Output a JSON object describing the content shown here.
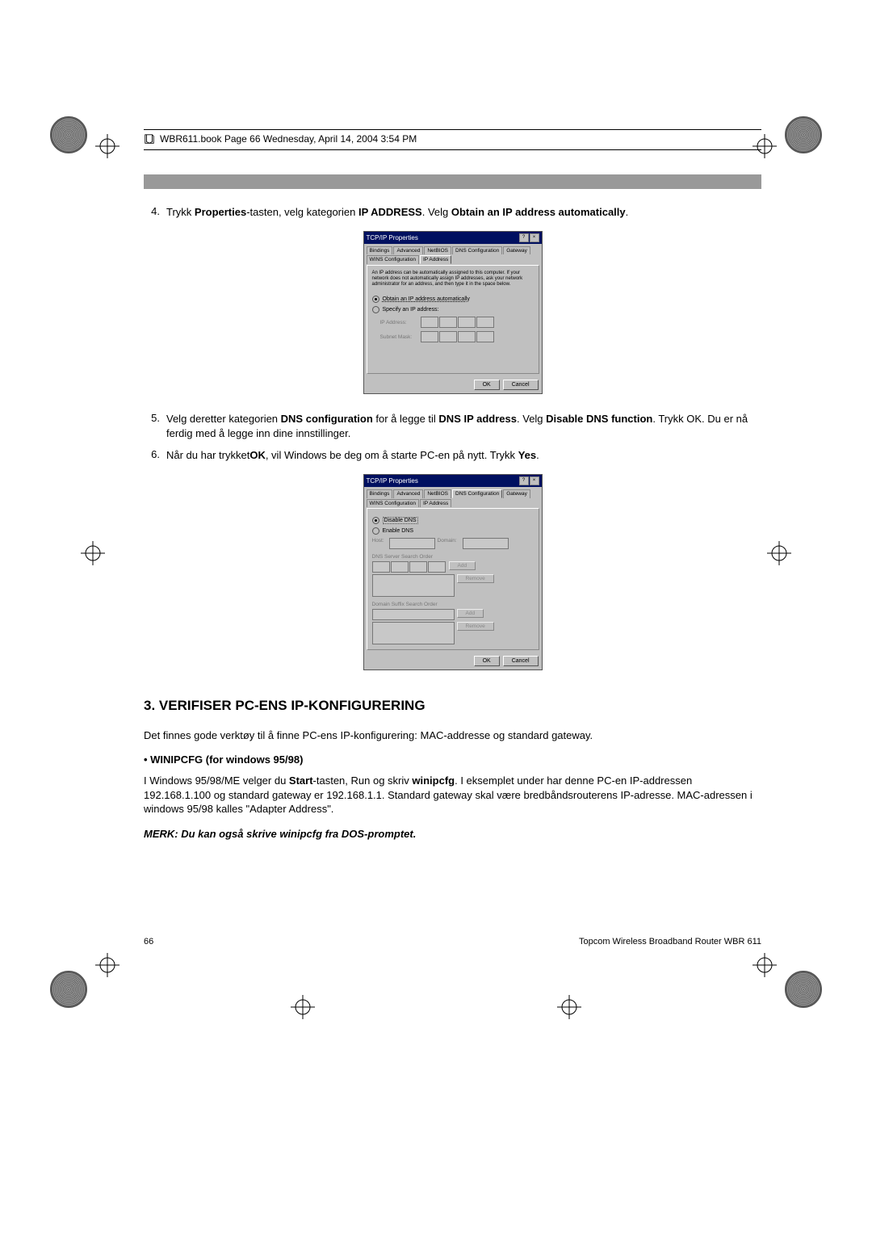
{
  "header": {
    "text": "WBR611.book  Page 66  Wednesday, April 14, 2004  3:54 PM"
  },
  "steps": {
    "s4_num": "4.",
    "s4_a": "Trykk ",
    "s4_b": "Properties",
    "s4_c": "-tasten, velg kategorien ",
    "s4_d": "IP ADDRESS",
    "s4_e": ". Velg ",
    "s4_f": "Obtain an IP address automatically",
    "s4_g": ".",
    "s5_num": "5.",
    "s5_a": "Velg deretter kategorien ",
    "s5_b": "DNS configuration",
    "s5_c": " for å legge til ",
    "s5_d": "DNS IP address",
    "s5_e": ". Velg ",
    "s5_f": "Disable DNS function",
    "s5_g": ". Trykk OK. Du er nå ferdig med å legge inn dine innstillinger.",
    "s6_num": "6.",
    "s6_a": "Når du har trykket",
    "s6_b": "OK",
    "s6_c": ", vil Windows be deg om å starte PC-en på nytt. Trykk ",
    "s6_d": "Yes",
    "s6_e": "."
  },
  "dialog1": {
    "title": "TCP/IP Properties",
    "tabs": {
      "bindings": "Bindings",
      "advanced": "Advanced",
      "netbios": "NetBIOS",
      "dnscfg": "DNS Configuration",
      "gateway": "Gateway",
      "winscfg": "WINS Configuration",
      "ipaddr": "IP Address"
    },
    "hint": "An IP address can be automatically assigned to this computer. If your network does not automatically assign IP addresses, ask your network administrator for an address, and then type it in the space below.",
    "radio_auto": "Obtain an IP address automatically",
    "radio_spec": "Specify an IP address:",
    "lbl_ip": "IP Address:",
    "lbl_mask": "Subnet Mask:",
    "ok": "OK",
    "cancel": "Cancel"
  },
  "dialog2": {
    "title": "TCP/IP Properties",
    "radio_disable": "Disable DNS",
    "radio_enable": "Enable DNS",
    "lbl_host": "Host:",
    "lbl_domain": "Domain:",
    "lbl_search": "DNS Server Search Order",
    "lbl_suffix": "Domain Suffix Search Order",
    "add": "Add",
    "remove": "Remove",
    "ok": "OK",
    "cancel": "Cancel"
  },
  "section_title": "3.   VERIFISER PC-ENS IP-KONFIGURERING",
  "para1": "Det finnes gode verktøy til å finne PC-ens IP-konfigurering: MAC-addresse og standard gateway.",
  "sub1": "• WINIPCFG (for windows 95/98)",
  "para2_a": "I Windows 95/98/ME velger du  ",
  "para2_b": "Start",
  "para2_c": "-tasten, Run og skriv ",
  "para2_d": "winipcfg",
  "para2_e": ". I eksemplet under har denne PC-en IP-addressen 192.168.1.100 og standard gateway er 192.168.1.1. Standard gateway skal være bredbåndsrouterens IP-adresse. MAC-adressen i windows 95/98 kalles \"Adapter Address\".",
  "note": "MERK: Du kan også skrive winipcfg fra DOS-promptet.",
  "footer": {
    "page": "66",
    "product": "Topcom Wireless Broadband Router WBR 611"
  }
}
